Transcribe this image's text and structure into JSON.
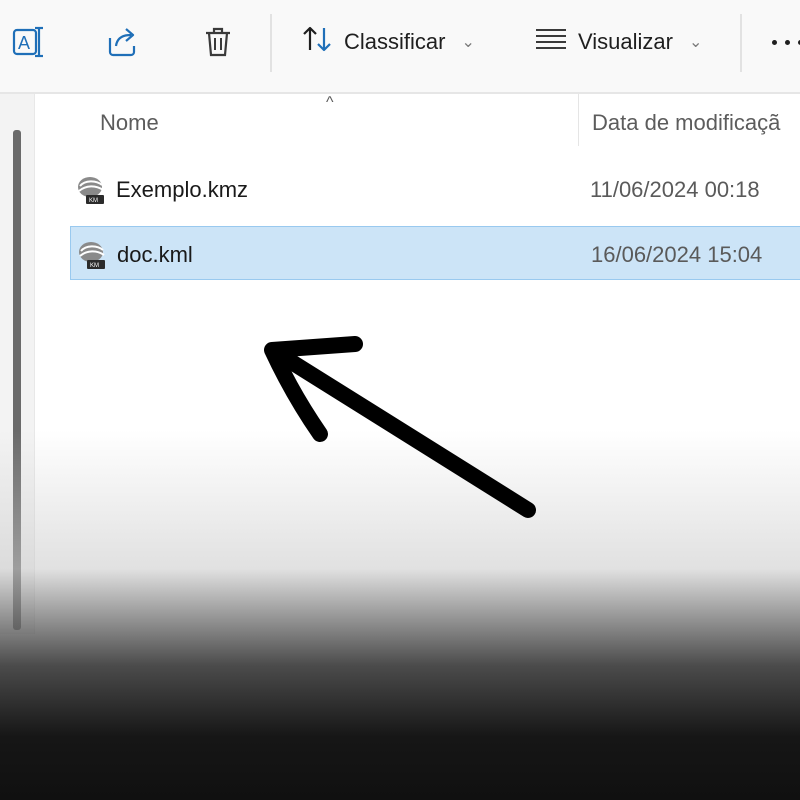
{
  "toolbar": {
    "sort_label": "Classificar",
    "view_label": "Visualizar",
    "icons": [
      "rename-icon",
      "share-icon",
      "delete-icon",
      "sort-icon",
      "view-icon",
      "more-icon"
    ]
  },
  "file_list": {
    "columns": [
      "Nome",
      "Data de modificaçã"
    ],
    "sort_indicator": "^",
    "rows": [
      {
        "name": "Exemplo.kmz",
        "modified": "11/06/2024 00:18",
        "icon": "kml-file-icon",
        "selected": false
      },
      {
        "name": "doc.kml",
        "modified": "16/06/2024 15:04",
        "icon": "kml-file-icon",
        "selected": true
      }
    ]
  },
  "colors": {
    "selection_bg": "#cce4f7",
    "selection_border": "#99c9ef",
    "toolbar_bg": "#f9f9f9",
    "icon_blue": "#1f6fb8",
    "annotation_arrow": "#000000"
  }
}
